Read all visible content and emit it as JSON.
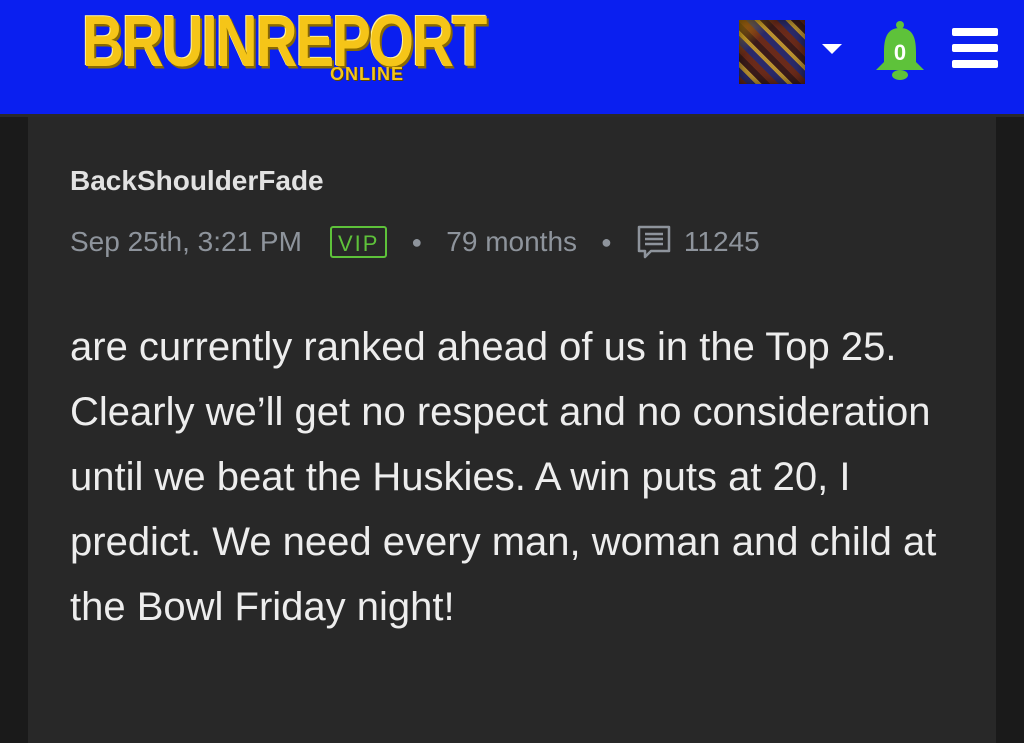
{
  "header": {
    "logo_main": "BRUINREPORT",
    "logo_sub": "ONLINE",
    "notification_count": "0",
    "colors": {
      "background": "#0a1ff0",
      "logo": "#f5c518",
      "bell": "#5ec23a"
    },
    "icons": [
      "user-avatar",
      "dropdown-caret-icon",
      "bell-icon",
      "menu-icon"
    ]
  },
  "post": {
    "author": "BackShoulderFade",
    "timestamp": "Sep 25th, 3:21 PM",
    "badge": "VIP",
    "membership": "79 months",
    "post_count": "11245",
    "body": "are currently ranked ahead of us in the Top 25. Clearly we’ll get no respect and no consideration until we beat the Huskies. A win puts at 20, I predict. We need every man, woman and child at the Bowl Friday night!"
  }
}
